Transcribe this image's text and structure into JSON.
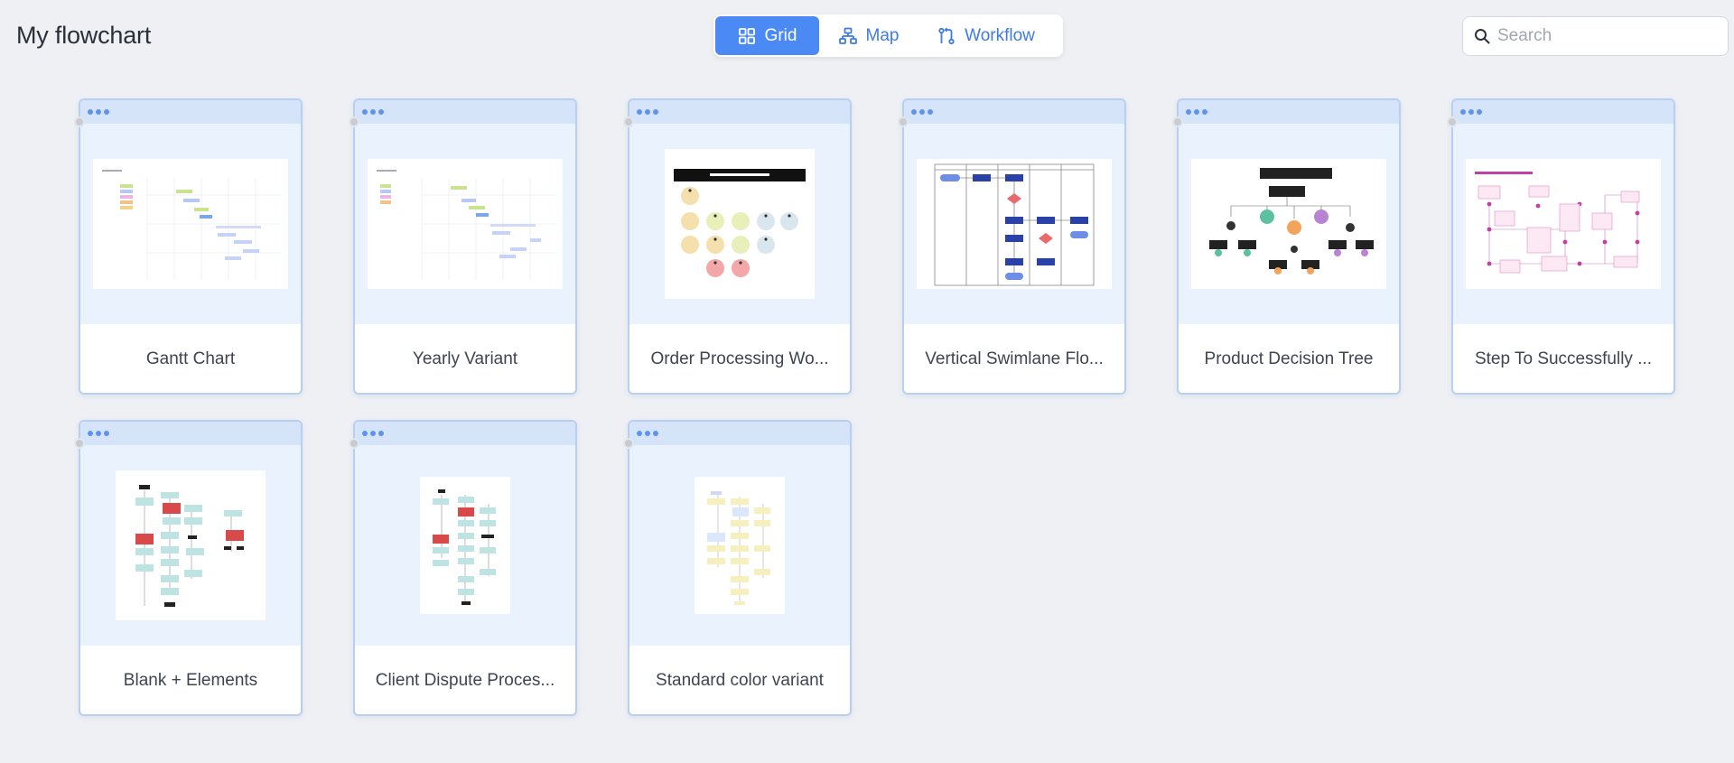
{
  "page": {
    "title": "My flowchart"
  },
  "view_switch": {
    "items": [
      {
        "label": "Grid",
        "icon": "grid-icon",
        "active": true
      },
      {
        "label": "Map",
        "icon": "sitemap-icon",
        "active": false
      },
      {
        "label": "Workflow",
        "icon": "workflow-icon",
        "active": false
      }
    ]
  },
  "search": {
    "placeholder": "Search",
    "value": ""
  },
  "cards": [
    {
      "title": "Gantt Chart",
      "thumbnail": "gantt-chart-thumbnail"
    },
    {
      "title": "Yearly Variant",
      "thumbnail": "gantt-chart-thumbnail"
    },
    {
      "title": "Order Processing Wo...",
      "thumbnail": "circle-workflow-thumbnail"
    },
    {
      "title": "Vertical Swimlane Flo...",
      "thumbnail": "swimlane-thumbnail"
    },
    {
      "title": "Product Decision Tree",
      "thumbnail": "decision-tree-thumbnail"
    },
    {
      "title": "Step To Successfully ...",
      "thumbnail": "pink-flow-thumbnail"
    },
    {
      "title": "Blank + Elements",
      "thumbnail": "red-teal-flow-thumbnail"
    },
    {
      "title": "Client Dispute Proces...",
      "thumbnail": "red-teal-flow-thumbnail"
    },
    {
      "title": "Standard color variant",
      "thumbnail": "yellow-flow-thumbnail"
    }
  ],
  "colors": {
    "accent": "#4b8af5",
    "card_border": "#b9cff2",
    "card_bar": "#d6e4f9",
    "background": "#eef0f4"
  }
}
